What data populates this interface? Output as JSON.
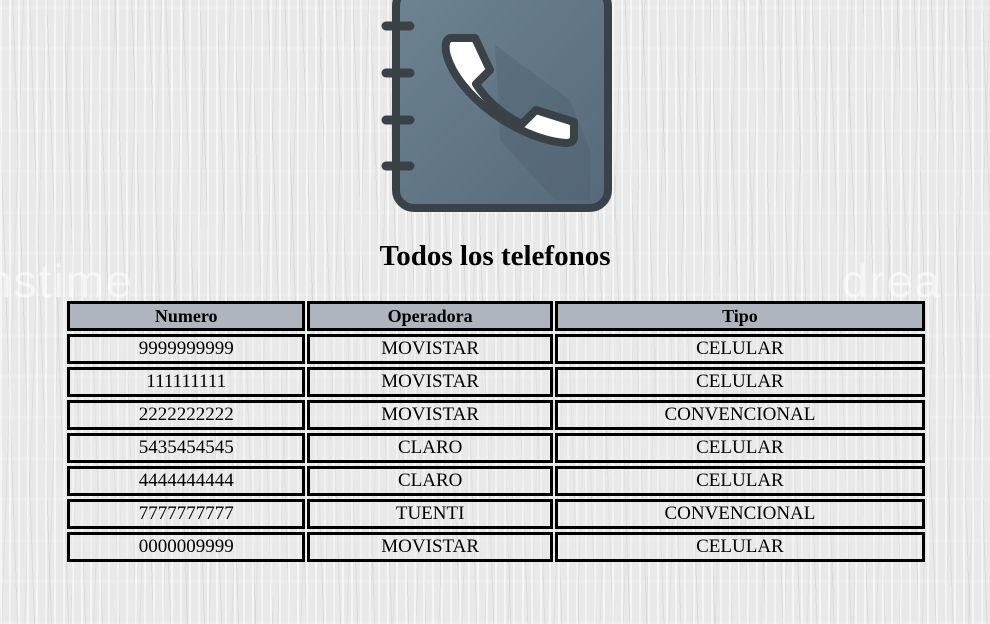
{
  "header": {
    "title": "Todos los telefonos",
    "icon": "phone-book-icon"
  },
  "watermark": {
    "left": "nstime",
    "right": "drea"
  },
  "table": {
    "columns": [
      "Numero",
      "Operadora",
      "Tipo"
    ],
    "rows": [
      [
        "9999999999",
        "MOVISTAR",
        "CELULAR"
      ],
      [
        "111111111",
        "MOVISTAR",
        "CELULAR"
      ],
      [
        "2222222222",
        "MOVISTAR",
        "CONVENCIONAL"
      ],
      [
        "5435454545",
        "CLARO",
        "CELULAR"
      ],
      [
        "4444444444",
        "CLARO",
        "CELULAR"
      ],
      [
        "7777777777",
        "TUENTI",
        "CONVENCIONAL"
      ],
      [
        "0000009999",
        "MOVISTAR",
        "CELULAR"
      ]
    ]
  },
  "colors": {
    "book_cover": "#5f7380",
    "book_border": "#3a4248",
    "header_background": "#aeb5bf"
  }
}
